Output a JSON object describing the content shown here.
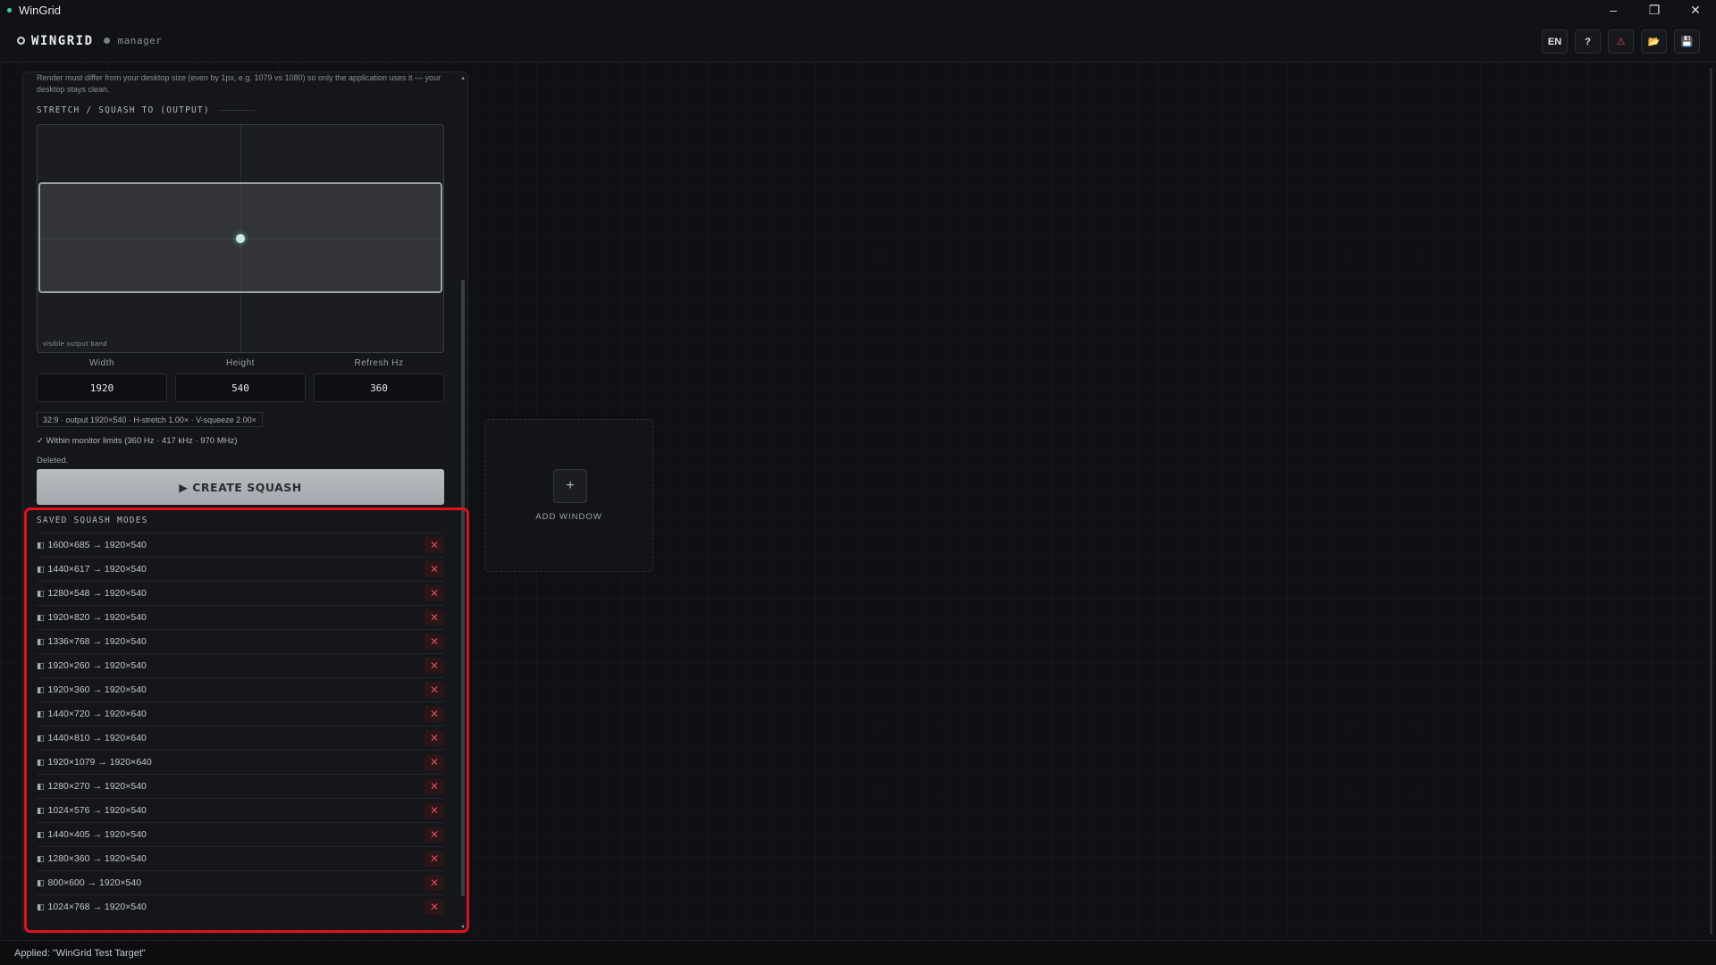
{
  "window": {
    "title": "WinGrid",
    "minimize": "–",
    "restore": "❐",
    "close": "✕"
  },
  "header": {
    "brand": "WINGRID",
    "subtitle": "manager",
    "tools": {
      "language": "EN",
      "help": "?",
      "warn": "⚠",
      "open": "📂",
      "save": "💾"
    }
  },
  "panel": {
    "note": "Render must differ from your desktop size (even by 1px, e.g. 1079 vs 1080) so only the application uses it — your desktop stays clean.",
    "stretch_label": "STRETCH / SQUASH TO (OUTPUT)",
    "preview_caption": "visible output band",
    "fields": {
      "width_label": "Width",
      "width_value": "1920",
      "height_label": "Height",
      "height_value": "540",
      "refresh_label": "Refresh Hz",
      "refresh_value": "360"
    },
    "summary": "32:9 · output 1920×540 · H-stretch 1.00× · V-squeeze 2.00×",
    "limits": "✓ Within monitor limits (360 Hz · 417 kHz · 970 MHz)",
    "status": "Deleted.",
    "create_button": "▶ CREATE SQUASH",
    "saved_label": "SAVED SQUASH MODES",
    "saved_modes": [
      "1600×685 → 1920×540",
      "1440×617 → 1920×540",
      "1280×548 → 1920×540",
      "1920×820 → 1920×540",
      "1336×768 → 1920×540",
      "1920×260 → 1920×540",
      "1920×360 → 1920×540",
      "1440×720 → 1920×640",
      "1440×810 → 1920×640",
      "1920×1079 → 1920×640",
      "1280×270 → 1920×540",
      "1024×576 → 1920×540",
      "1440×405 → 1920×540",
      "1280×360 → 1920×540",
      "800×600 → 1920×540",
      "1024×768 → 1920×540"
    ],
    "mode_icon": "◧",
    "delete_glyph": "✕"
  },
  "add_window": {
    "plus": "+",
    "label": "ADD WINDOW"
  },
  "footer": {
    "status": "Applied: \"WinGrid Test Target\""
  },
  "colors": {
    "accent": "#3fd0b0",
    "danger": "#e0495c",
    "highlight": "#e0111b"
  }
}
